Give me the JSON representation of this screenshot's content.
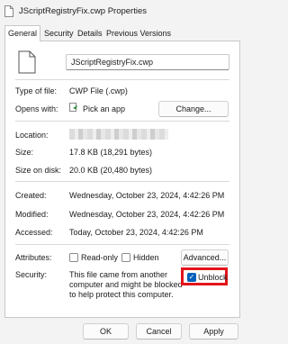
{
  "window": {
    "title": "JScriptRegistryFix.cwp Properties"
  },
  "tabs": [
    {
      "label": "General"
    },
    {
      "label": "Security"
    },
    {
      "label": "Details"
    },
    {
      "label": "Previous Versions"
    }
  ],
  "general": {
    "file_name": "JScriptRegistryFix.cwp",
    "type_label": "Type of file:",
    "type_value": "CWP File (.cwp)",
    "opens_label": "Opens with:",
    "opens_value": "Pick an app",
    "change_label": "Change...",
    "location_label": "Location:",
    "size_label": "Size:",
    "size_value": "17.8 KB (18,291 bytes)",
    "size_disk_label": "Size on disk:",
    "size_disk_value": "20.0 KB (20,480 bytes)",
    "created_label": "Created:",
    "created_value": "Wednesday, October 23, 2024, 4:42:26 PM",
    "modified_label": "Modified:",
    "modified_value": "Wednesday, October 23, 2024, 4:42:26 PM",
    "accessed_label": "Accessed:",
    "accessed_value": "Today, October 23, 2024, 4:42:26 PM",
    "attributes_label": "Attributes:",
    "readonly_label": "Read-only",
    "hidden_label": "Hidden",
    "advanced_label": "Advanced...",
    "security_label": "Security:",
    "security_text": "This file came from another computer and might be blocked to help protect this computer.",
    "unblock_label": "Unblock",
    "unblock_checked": true
  },
  "footer": {
    "ok": "OK",
    "cancel": "Cancel",
    "apply": "Apply"
  },
  "colors": {
    "accent": "#005fb8",
    "highlight": "#e3141b"
  },
  "icons": {
    "title": "file-icon",
    "big": "file-icon",
    "opens": "pick-app-icon",
    "check": "check-icon"
  }
}
